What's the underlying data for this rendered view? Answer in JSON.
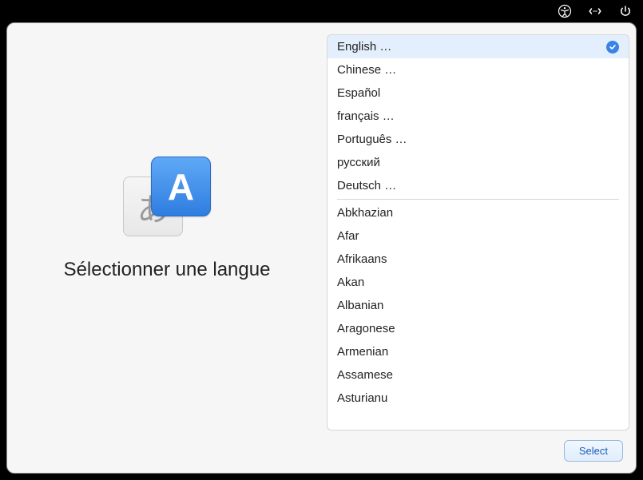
{
  "menubar": {
    "icons": [
      "accessibility",
      "input-method",
      "power"
    ]
  },
  "left": {
    "icon_back_glyph": "あ",
    "icon_front_glyph": "A",
    "heading": "Sélectionner une langue"
  },
  "languages": {
    "featured": [
      {
        "label": "English …",
        "selected": true
      },
      {
        "label": "Chinese …",
        "selected": false
      },
      {
        "label": "Español",
        "selected": false
      },
      {
        "label": "français …",
        "selected": false
      },
      {
        "label": "Português …",
        "selected": false
      },
      {
        "label": "русский",
        "selected": false
      },
      {
        "label": "Deutsch …",
        "selected": false
      }
    ],
    "all": [
      {
        "label": "Abkhazian"
      },
      {
        "label": "Afar"
      },
      {
        "label": "Afrikaans"
      },
      {
        "label": "Akan"
      },
      {
        "label": "Albanian"
      },
      {
        "label": "Aragonese"
      },
      {
        "label": "Armenian"
      },
      {
        "label": "Assamese"
      },
      {
        "label": "Asturianu"
      }
    ]
  },
  "footer": {
    "select_label": "Select"
  }
}
